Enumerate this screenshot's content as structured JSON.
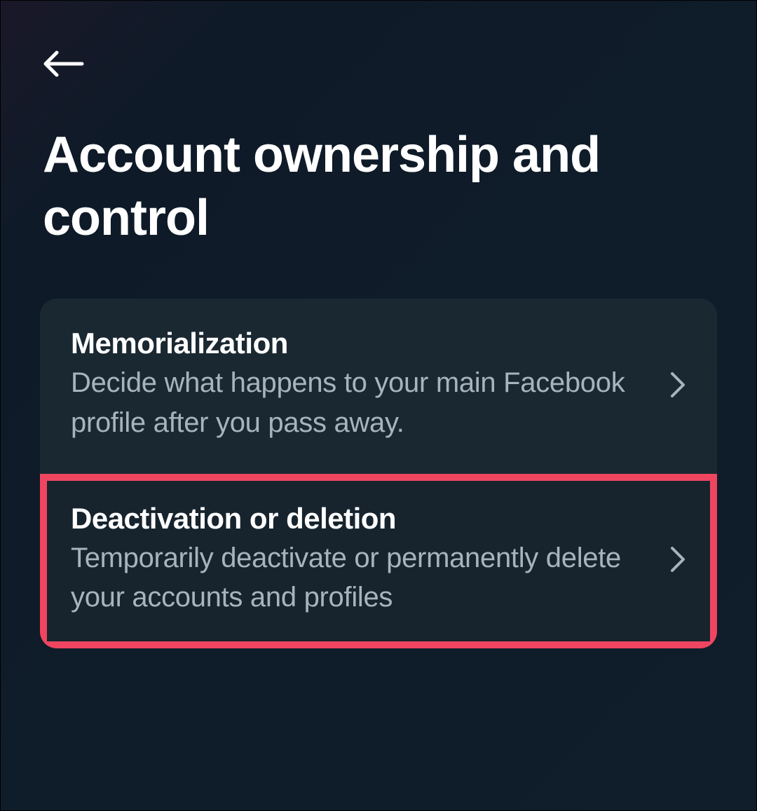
{
  "header": {
    "title": "Account ownership and control"
  },
  "settings": {
    "items": [
      {
        "title": "Memorialization",
        "description": "Decide what happens to your main Facebook profile after you pass away.",
        "highlighted": false
      },
      {
        "title": "Deactivation or deletion",
        "description": "Temporarily deactivate or permanently delete your accounts and profiles",
        "highlighted": true
      }
    ]
  },
  "colors": {
    "highlight": "#ef4560",
    "background": "#0f1e2a",
    "cardBackground": "#1a2832",
    "textPrimary": "#ffffff",
    "textSecondary": "#a8b4bd"
  }
}
